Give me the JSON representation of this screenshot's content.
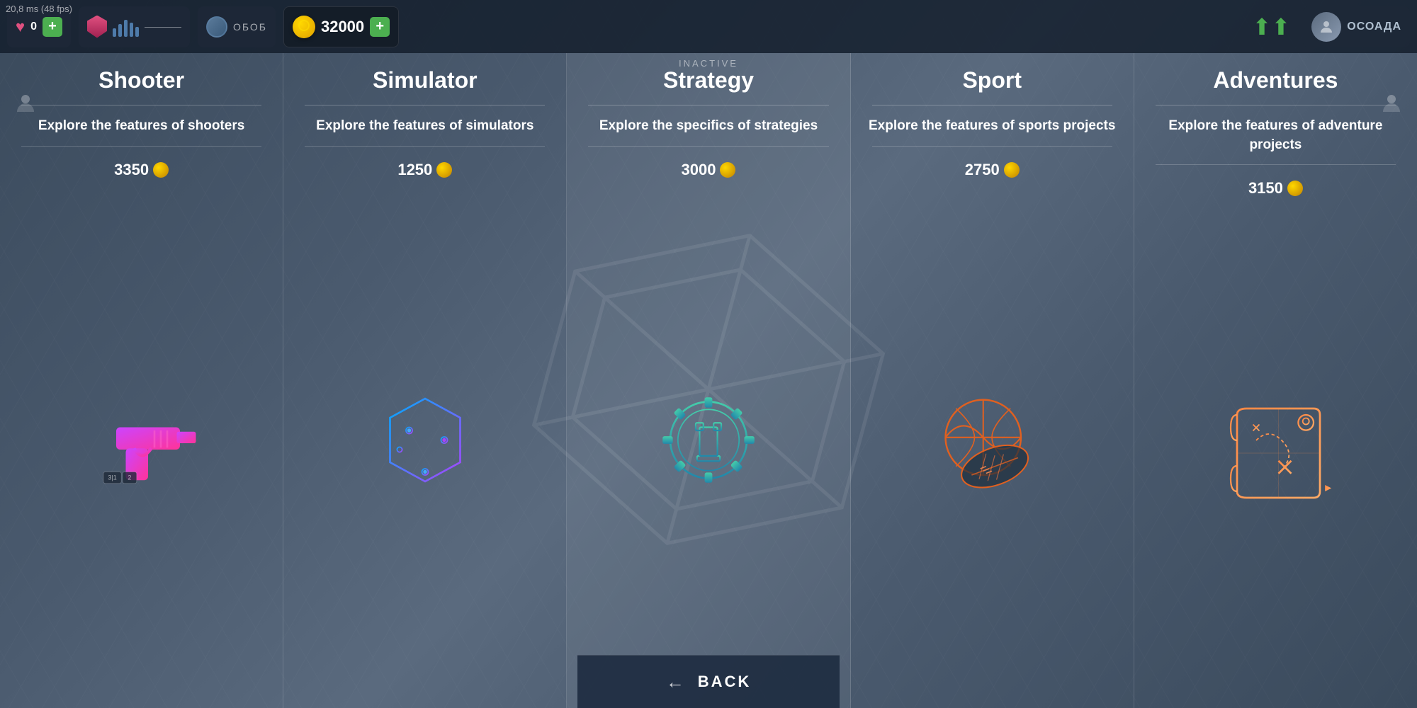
{
  "fps": "20,8 ms (48 fps)",
  "topbar": {
    "heart_count": "0",
    "add_label": "+",
    "currency_amount": "32000",
    "inactive_label": "INACTIVE",
    "arrows_up": "⬆⬆",
    "username": "ОСОАДА",
    "back_label": "BACK"
  },
  "columns": [
    {
      "id": "shooter",
      "title": "Shooter",
      "description": "Explore the features of shooters",
      "cost": "3350",
      "icon_type": "gun"
    },
    {
      "id": "simulator",
      "title": "Simulator",
      "description": "Explore the features of simulators",
      "cost": "1250",
      "icon_type": "cube"
    },
    {
      "id": "strategy",
      "title": "Strategy",
      "description": "Explore the specifics of strategies",
      "cost": "3000",
      "icon_type": "chess"
    },
    {
      "id": "sport",
      "title": "Sport",
      "description": "Explore the features of sports projects",
      "cost": "2750",
      "icon_type": "sports"
    },
    {
      "id": "adventures",
      "title": "Adventures",
      "description": "Explore the features of adventure projects",
      "cost": "3150",
      "icon_type": "map"
    }
  ]
}
